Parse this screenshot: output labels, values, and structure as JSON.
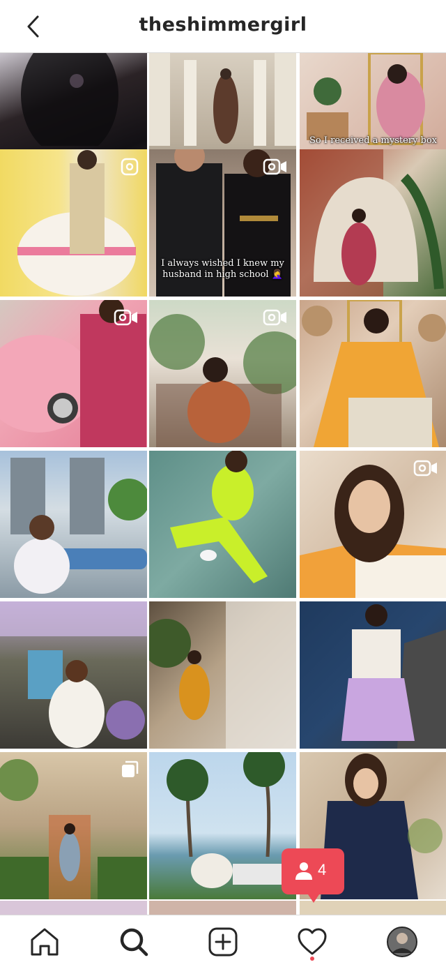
{
  "header": {
    "username": "theshimmergirl",
    "back_icon": "chevron-left-icon"
  },
  "posts": [
    {
      "type": "image",
      "caption": ""
    },
    {
      "type": "image",
      "caption": ""
    },
    {
      "type": "image",
      "caption": "So I received a mystery box"
    },
    {
      "type": "reel",
      "caption": ""
    },
    {
      "type": "reel",
      "caption": "I always wished I knew my husband in high school 🤦‍♀️"
    },
    {
      "type": "image",
      "caption": ""
    },
    {
      "type": "reel",
      "caption": ""
    },
    {
      "type": "reel",
      "caption": ""
    },
    {
      "type": "image",
      "caption": ""
    },
    {
      "type": "image",
      "caption": ""
    },
    {
      "type": "image",
      "caption": ""
    },
    {
      "type": "reel",
      "caption": ""
    },
    {
      "type": "image",
      "caption": ""
    },
    {
      "type": "image",
      "caption": ""
    },
    {
      "type": "image",
      "caption": ""
    },
    {
      "type": "carousel",
      "caption": ""
    },
    {
      "type": "image",
      "caption": ""
    },
    {
      "type": "image",
      "caption": ""
    }
  ],
  "notification": {
    "icon": "person-icon",
    "count": "4"
  },
  "tabbar": {
    "items": [
      "home-icon",
      "search-icon",
      "new-post-icon",
      "activity-heart-icon",
      "profile-avatar"
    ]
  },
  "colors": {
    "notification": "#ed4956",
    "divider": "#dbdbdb",
    "text": "#262626"
  }
}
